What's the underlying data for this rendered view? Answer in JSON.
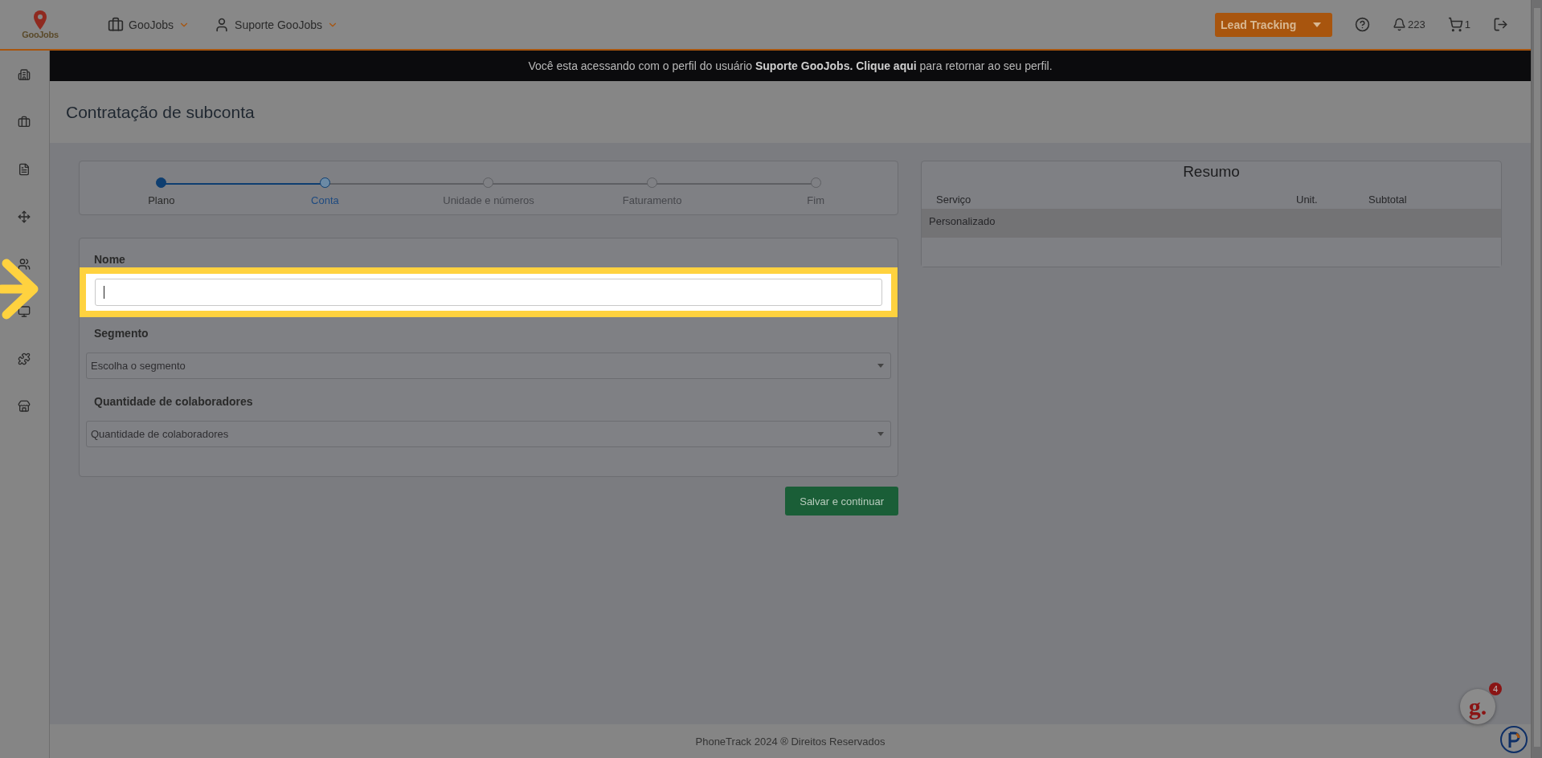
{
  "header": {
    "logo": "GooJobs",
    "menus": [
      {
        "label": "GooJobs",
        "kind": "briefcase"
      },
      {
        "label": "Suporte GooJobs",
        "kind": "user"
      }
    ],
    "lead_button": "Lead Tracking",
    "notifications": "223",
    "cart": "1"
  },
  "banner": {
    "message": "Você esta acessando com o perfil do usuário **Suporte GooJobs.**",
    "link": "Clique aqui",
    "after": "para retornar ao seu perfil."
  },
  "page_title": "Contratação de subconta",
  "stepper": [
    {
      "label": "Plano",
      "done": true,
      "current": false
    },
    {
      "label": "Conta",
      "done": false,
      "current": true
    },
    {
      "label": "Unidade e números",
      "done": false,
      "current": false
    },
    {
      "label": "Faturamento",
      "done": false,
      "current": false
    },
    {
      "label": "Fim",
      "done": false,
      "current": false
    }
  ],
  "form": {
    "fields": [
      {
        "kind": "text",
        "label": "Nome",
        "focused": true,
        "highlighted": true
      },
      {
        "kind": "select",
        "label": "Segmento",
        "placeholder": "Escolha o segmento"
      },
      {
        "kind": "select",
        "label": "Quantidade de colaboradores",
        "placeholder": "Quantidade de colaboradores"
      }
    ],
    "submit": "Salvar e continuar"
  },
  "summary": {
    "title": "Resumo",
    "columns": [
      "Serviço",
      "Unit.",
      "Subtotal"
    ],
    "rows": [
      [
        "Personalizado"
      ]
    ]
  },
  "footer": "PhoneTrack 2024 ® Direitos Reservados",
  "chat_widget": {
    "logo": "g.",
    "badge": "4"
  }
}
